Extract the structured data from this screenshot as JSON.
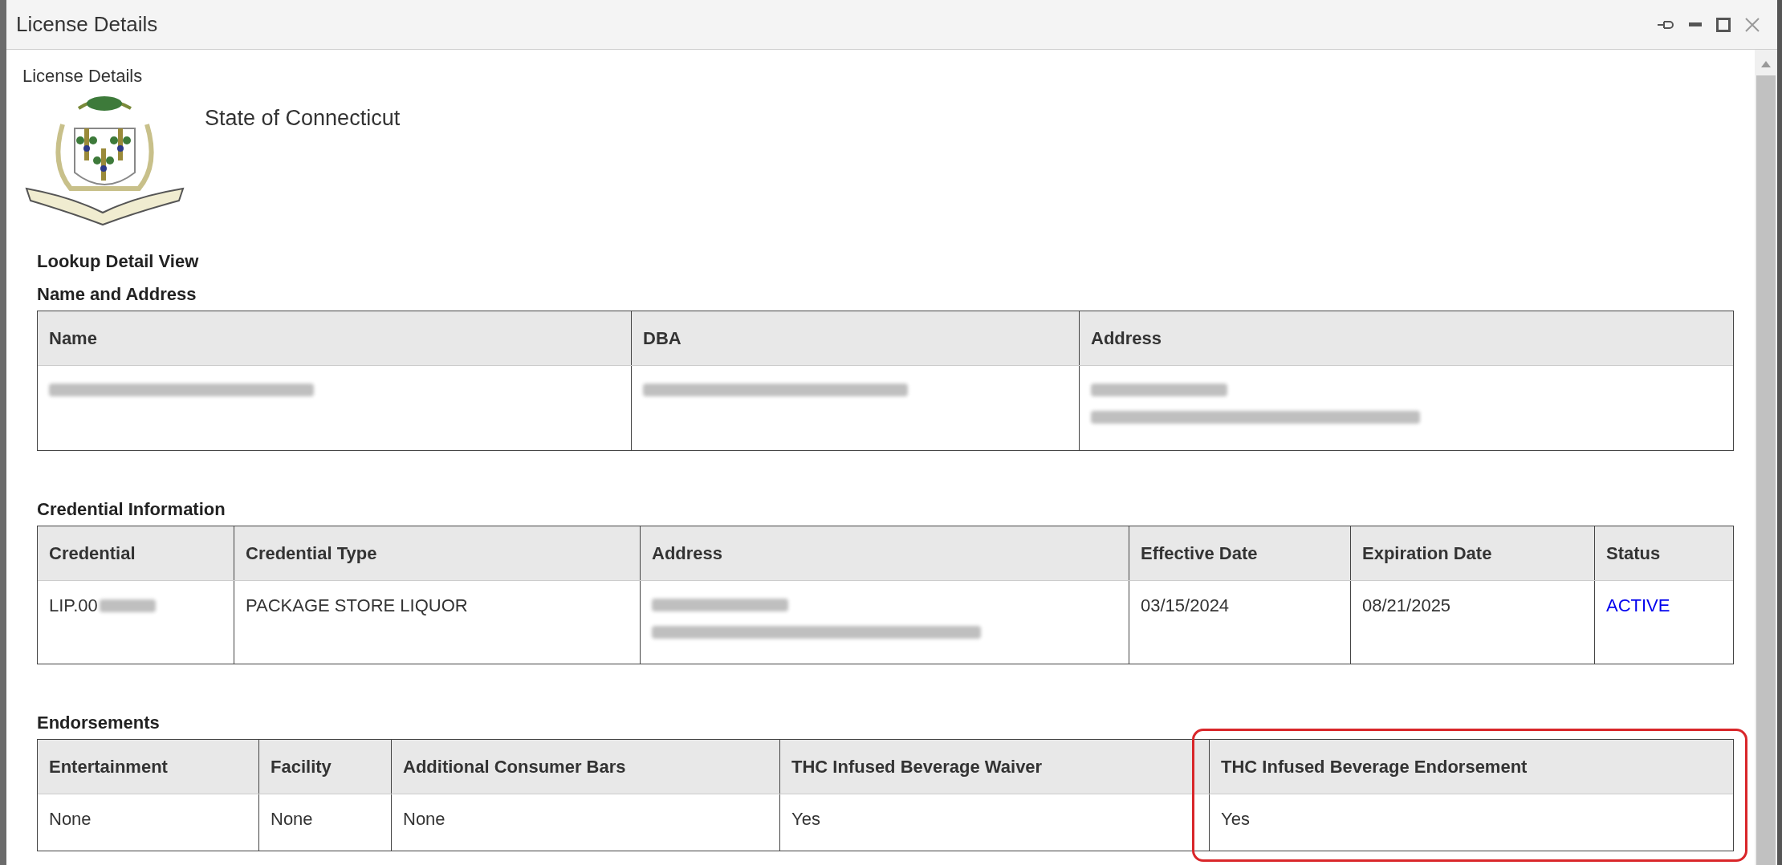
{
  "window": {
    "title": "License Details"
  },
  "page": {
    "heading": "License Details",
    "state_name": "State of Connecticut",
    "view_title": "Lookup Detail View"
  },
  "tables": [
    {
      "title": "Name and Address",
      "columns": [
        {
          "label": "Name",
          "highlighted": false
        },
        {
          "label": "DBA",
          "highlighted": false
        },
        {
          "label": "Address",
          "highlighted": false
        }
      ],
      "rows": [
        [
          {
            "kind": "redacted"
          },
          {
            "kind": "redacted"
          },
          {
            "kind": "redacted_2line"
          }
        ]
      ]
    },
    {
      "title": "Credential Information",
      "columns": [
        {
          "label": "Credential",
          "highlighted": false
        },
        {
          "label": "Credential Type",
          "highlighted": false
        },
        {
          "label": "Address",
          "highlighted": false
        },
        {
          "label": "Effective Date",
          "highlighted": false
        },
        {
          "label": "Expiration Date",
          "highlighted": false
        },
        {
          "label": "Status",
          "highlighted": false
        }
      ],
      "rows": [
        [
          {
            "kind": "text_redacted",
            "text": "LIP.00"
          },
          {
            "kind": "text",
            "text": "PACKAGE STORE LIQUOR"
          },
          {
            "kind": "redacted_2line"
          },
          {
            "kind": "text",
            "text": "03/15/2024"
          },
          {
            "kind": "text",
            "text": "08/21/2025"
          },
          {
            "kind": "link",
            "text": "ACTIVE"
          }
        ]
      ]
    },
    {
      "title": "Endorsements",
      "columns": [
        {
          "label": "Entertainment",
          "highlighted": false
        },
        {
          "label": "Facility",
          "highlighted": false
        },
        {
          "label": "Additional Consumer Bars",
          "highlighted": false
        },
        {
          "label": "THC Infused Beverage Waiver",
          "highlighted": false
        },
        {
          "label": "THC Infused Beverage Endorsement",
          "highlighted": true
        }
      ],
      "rows": [
        [
          {
            "kind": "text",
            "text": "None"
          },
          {
            "kind": "text",
            "text": "None"
          },
          {
            "kind": "text",
            "text": "None"
          },
          {
            "kind": "text",
            "text": "Yes"
          },
          {
            "kind": "text",
            "text": "Yes"
          }
        ]
      ]
    }
  ]
}
